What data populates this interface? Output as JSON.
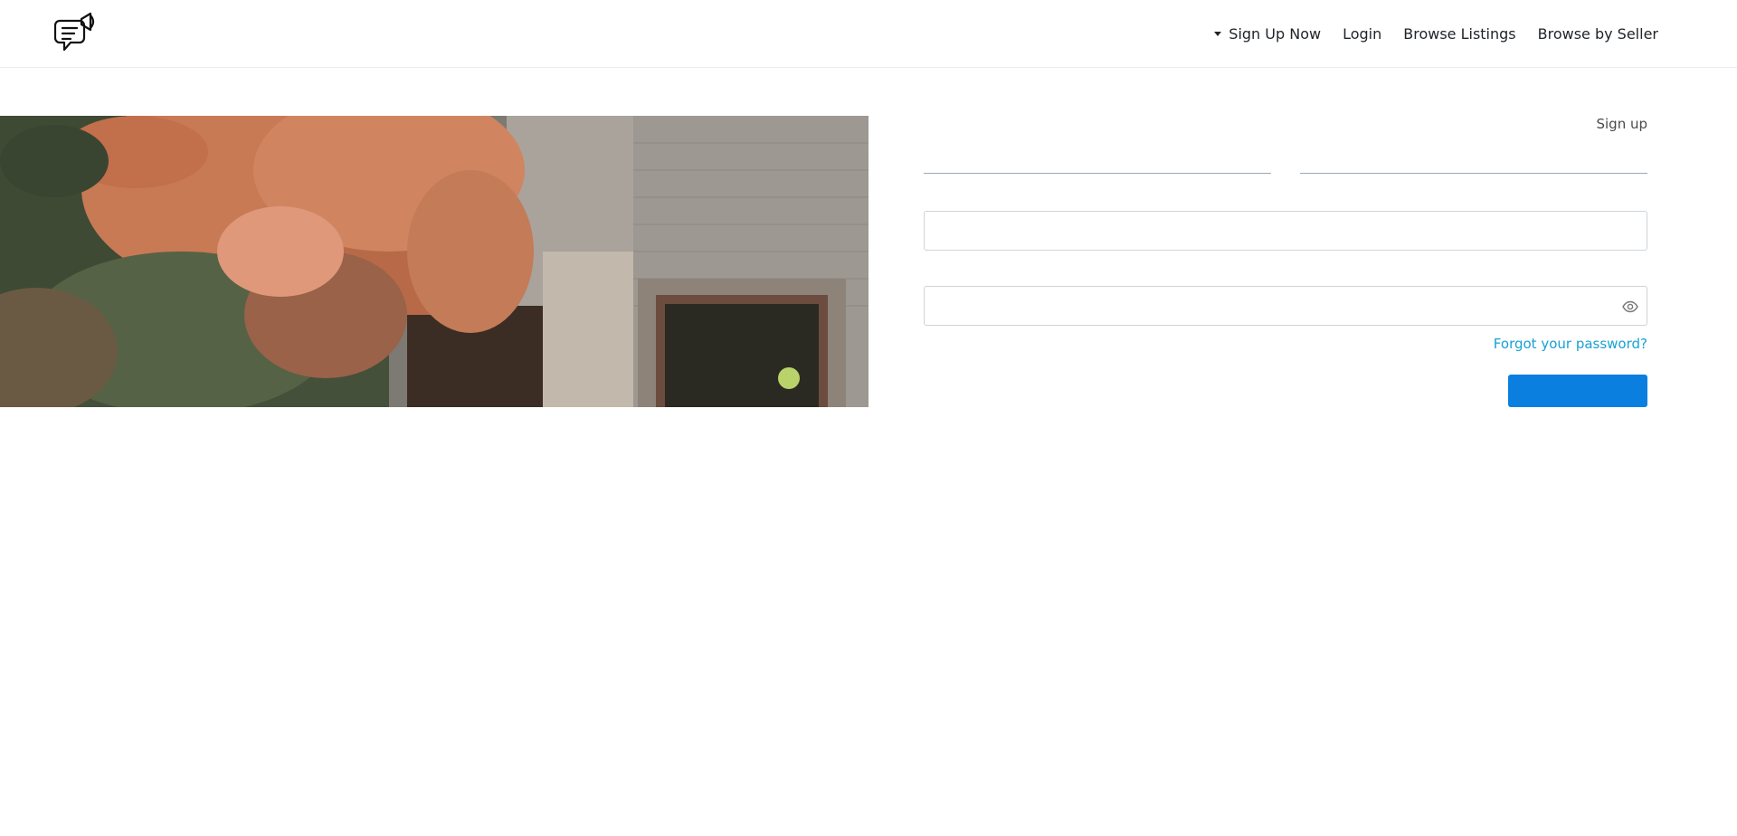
{
  "header": {
    "logo_icon": "megaphone-chat-icon",
    "nav": [
      {
        "label": "Sign Up Now",
        "has_dropdown": true
      },
      {
        "label": "Login"
      },
      {
        "label": "Browse Listings"
      },
      {
        "label": "Browse by Seller"
      }
    ]
  },
  "hero": {
    "image": "ivy-covered-building-photo"
  },
  "form": {
    "signup_link": "Sign up",
    "first_name": {
      "value": "",
      "placeholder": ""
    },
    "last_name": {
      "value": "",
      "placeholder": ""
    },
    "email": {
      "value": "",
      "placeholder": ""
    },
    "password": {
      "value": "",
      "placeholder": ""
    },
    "eye_icon": "eye-icon",
    "forgot_password": "Forgot your password?",
    "submit_label": ""
  },
  "colors": {
    "primary_button": "#0a7fe0",
    "link": "#17a2d4",
    "border": "#ced4da"
  }
}
